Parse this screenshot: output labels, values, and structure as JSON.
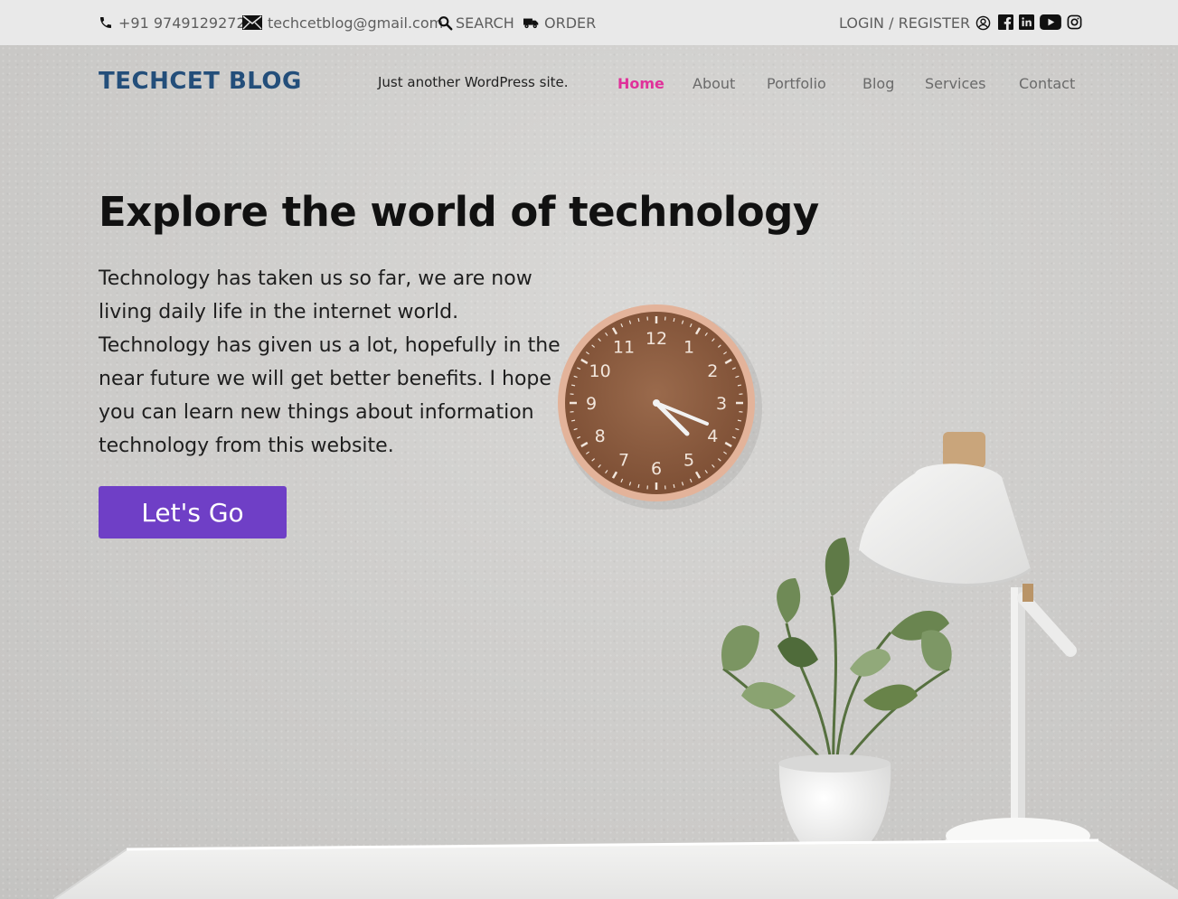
{
  "topbar": {
    "phone": "+91 9749129272",
    "email": "techcetblog@gmail.com",
    "search": "SEARCH",
    "order": "ORDER",
    "login": "LOGIN / REGISTER",
    "social": [
      "facebook-icon",
      "linkedin-icon",
      "youtube-icon",
      "instagram-icon"
    ]
  },
  "header": {
    "brand": "TECHCET BLOG",
    "tagline": "Just another WordPress site."
  },
  "nav": {
    "items": [
      {
        "label": "Home",
        "active": true
      },
      {
        "label": "About"
      },
      {
        "label": "Portfolio"
      },
      {
        "label": "Blog"
      },
      {
        "label": "Services"
      },
      {
        "label": "Contact"
      }
    ]
  },
  "hero": {
    "headline": "Explore the world of technology",
    "body": "Technology has taken us so far, we are now living daily life in the internet world. Technology has given us a lot, hopefully in the near future we will get better benefits. I hope you can learn new things about information technology from this website.",
    "cta": "Let's Go"
  },
  "clock": {
    "numbers": [
      "12",
      "1",
      "2",
      "3",
      "4",
      "5",
      "6",
      "7",
      "8",
      "9",
      "10",
      "11"
    ]
  },
  "colors": {
    "brand": "#234e7a",
    "nav_active": "#e0319a",
    "cta": "#6f3fc6",
    "topbar": "#e9e9e9"
  }
}
